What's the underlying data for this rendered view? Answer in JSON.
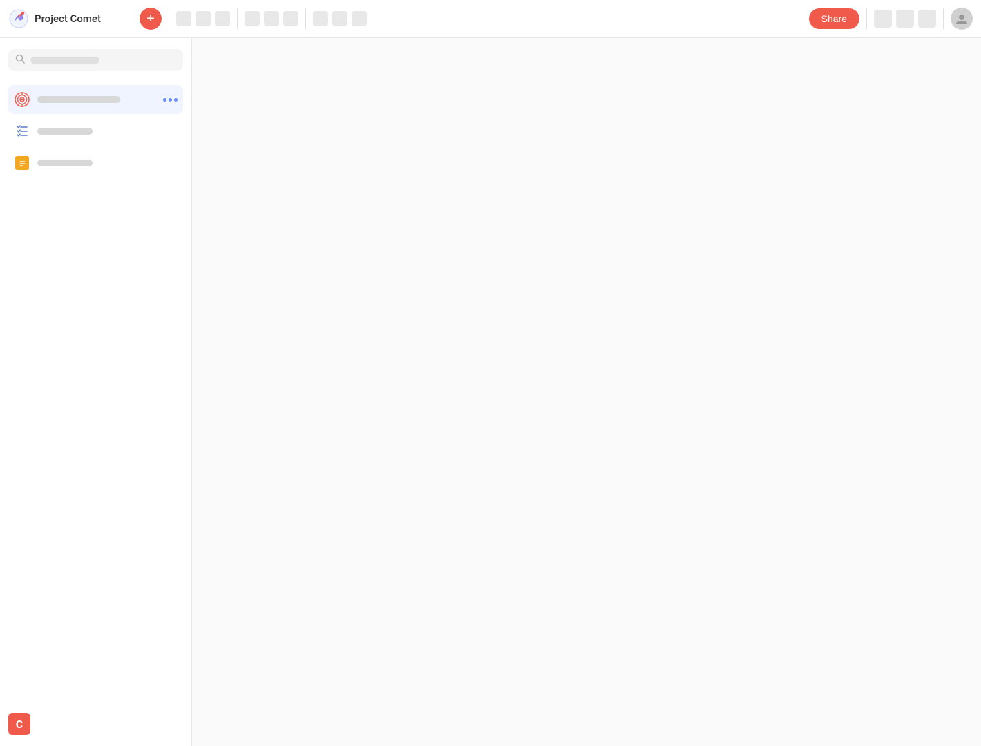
{
  "header": {
    "title": "Project Comet",
    "add_button_label": "+",
    "share_button_label": "Share",
    "toolbar_groups": [
      {
        "dots": 3
      },
      {
        "dots": 3
      },
      {
        "dots": 3
      }
    ],
    "right_icons": 3
  },
  "sidebar": {
    "search_placeholder": "",
    "items": [
      {
        "id": "goals",
        "icon": "target-icon",
        "active": true,
        "has_more": true
      },
      {
        "id": "checklist",
        "icon": "checklist-icon",
        "active": false,
        "has_more": false
      },
      {
        "id": "notes",
        "icon": "note-icon",
        "active": false,
        "has_more": false
      }
    ],
    "bottom_logo_letter": "C"
  }
}
